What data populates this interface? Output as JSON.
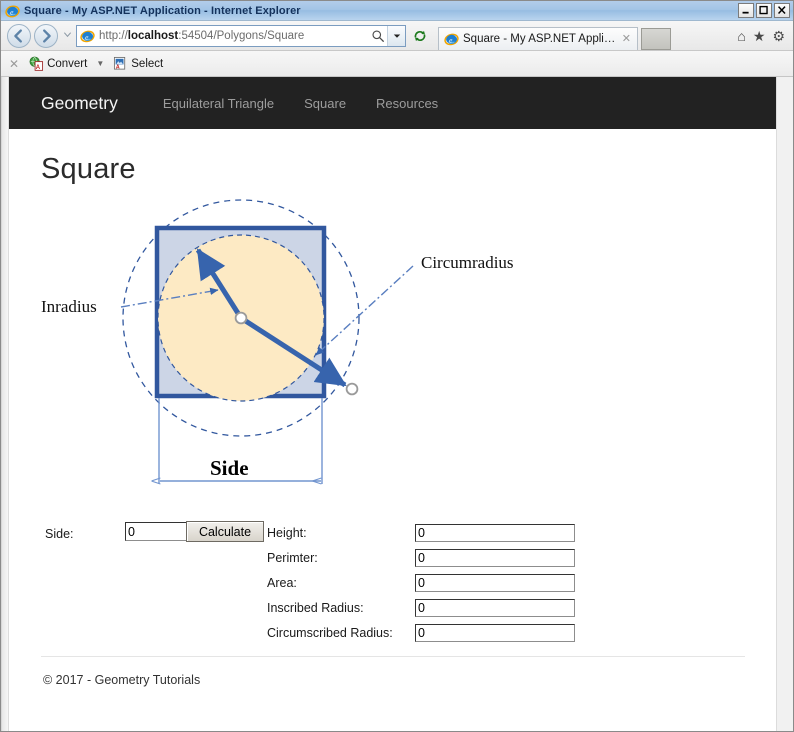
{
  "window": {
    "title": "Square - My ASP.NET Application - Internet Explorer",
    "ie_icon": "internet-explorer-icon",
    "minimize_label": "_",
    "maximize_label": "□",
    "close_label": "✕"
  },
  "browser": {
    "back_label": "◀",
    "forward_label": "▶",
    "history_caret": "▽",
    "address": {
      "scheme": "http://",
      "host": "localhost",
      "rest": ":54504/Polygons/Square",
      "full_url": "http://localhost:54504/Polygons/Square",
      "search_icon": "search-icon",
      "dropdown_icon": "chevron-down-icon"
    },
    "refresh_label": "↻",
    "tab": {
      "title": "Square - My ASP.NET Applic...",
      "close_label": "✕"
    },
    "toolbar_icons": {
      "home": "⌂",
      "favorites": "★",
      "tools": "⚙"
    }
  },
  "command_bar": {
    "close_label": "✕",
    "items": [
      {
        "label": "Convert",
        "icon": "pdf-convert-icon",
        "has_dropdown": true,
        "dropdown_label": "▼"
      },
      {
        "label": "Select",
        "icon": "pdf-select-icon",
        "has_dropdown": false
      }
    ]
  },
  "site": {
    "brand": "Geometry",
    "nav_links": [
      {
        "label": "Equilateral Triangle"
      },
      {
        "label": "Square"
      },
      {
        "label": "Resources"
      }
    ],
    "page_title": "Square",
    "footer": "© 2017 - Geometry Tutorials"
  },
  "diagram": {
    "labels": {
      "inradius": "Inradius",
      "circumradius": "Circumradius",
      "side": "Side"
    },
    "colors": {
      "square_fill": "#ccd5e6",
      "square_stroke": "#31579e",
      "circle_fill": "#fdeac4",
      "circle_stroke": "#31579e",
      "dashed_stroke": "#31579e",
      "arrow": "#3764ad",
      "dimension": "#7295cf"
    }
  },
  "form": {
    "side_label": "Side:",
    "side_value": "0",
    "calculate_label": "Calculate",
    "results": [
      {
        "label": "Height:",
        "value": "0"
      },
      {
        "label": "Perimter:",
        "value": "0"
      },
      {
        "label": "Area:",
        "value": "0"
      },
      {
        "label": "Inscribed Radius:",
        "value": "0"
      },
      {
        "label": "Circumscribed Radius:",
        "value": "0"
      }
    ]
  }
}
